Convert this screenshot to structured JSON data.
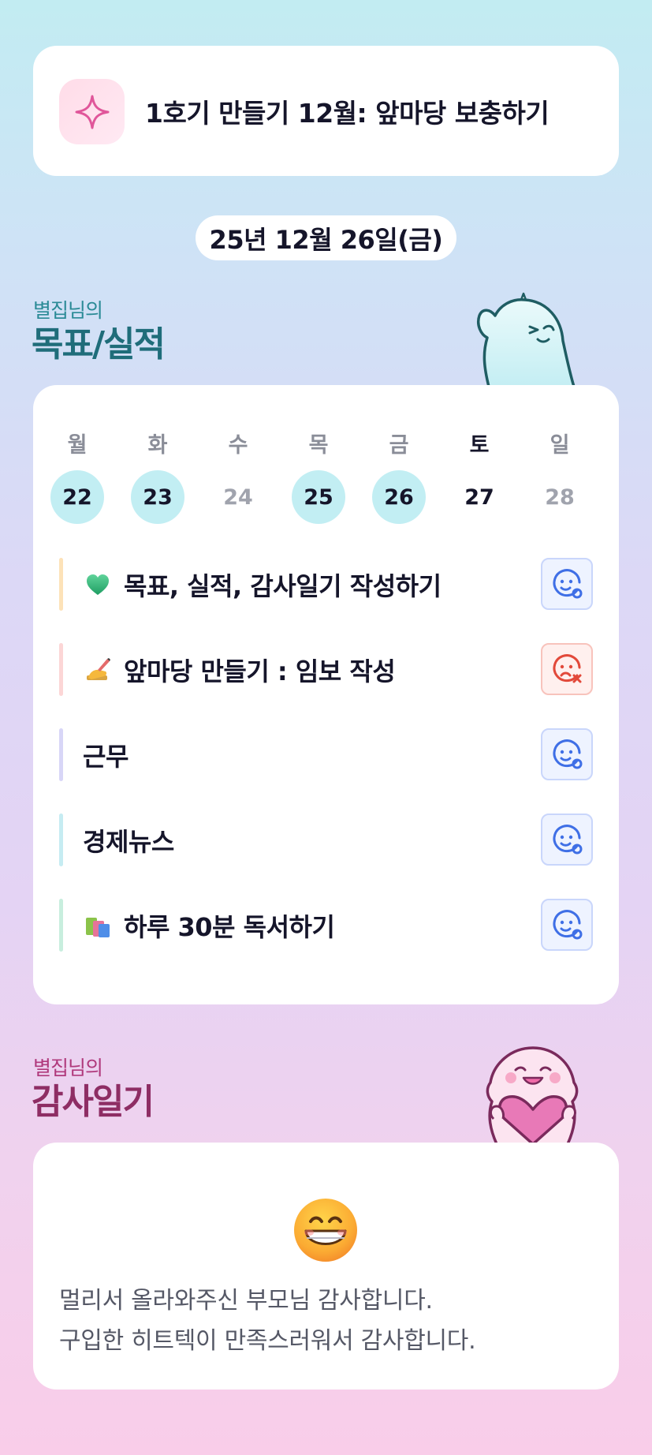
{
  "header": {
    "title": "1호기 만들기 12월: 앞마당 보충하기",
    "icon": "sparkle-icon"
  },
  "date": "25년 12월 26일(금)",
  "goals_section": {
    "subtitle": "별집님의",
    "title": "목표/실적"
  },
  "week": [
    {
      "day": "월",
      "date": "22",
      "done": true
    },
    {
      "day": "화",
      "date": "23",
      "done": true
    },
    {
      "day": "수",
      "date": "24",
      "done": false
    },
    {
      "day": "목",
      "date": "25",
      "done": true
    },
    {
      "day": "금",
      "date": "26",
      "done": true
    },
    {
      "day": "토",
      "date": "27",
      "done": false,
      "today": true
    },
    {
      "day": "일",
      "date": "28",
      "done": false
    }
  ],
  "tasks": [
    {
      "label": "목표, 실적, 감사일기 작성하기",
      "emoji": "green-heart-icon",
      "bar_color": "#fde2b8",
      "status": "ok"
    },
    {
      "label": "앞마당 만들기 : 임보 작성",
      "emoji": "writing-hand-icon",
      "bar_color": "#fcd6d6",
      "status": "fail"
    },
    {
      "label": "근무",
      "emoji": "",
      "bar_color": "#d8d6f7",
      "status": "ok"
    },
    {
      "label": "경제뉴스",
      "emoji": "",
      "bar_color": "#c6ecf2",
      "status": "ok"
    },
    {
      "label": "하루 30분 독서하기",
      "emoji": "books-icon",
      "bar_color": "#c8eede",
      "status": "ok"
    }
  ],
  "diary_section": {
    "subtitle": "별집님의",
    "title": "감사일기"
  },
  "diary": {
    "emoji": "grinning-face-icon",
    "lines": [
      "멀리서 올라와주신 부모님 감사합니다.",
      "구입한 히트텍이 만족스러워서 감사합니다."
    ]
  },
  "colors": {
    "accent_teal": "#1f6d7a",
    "accent_pink": "#8e2d64",
    "status_ok": "#3f6fe6",
    "status_fail": "#e2493a"
  }
}
